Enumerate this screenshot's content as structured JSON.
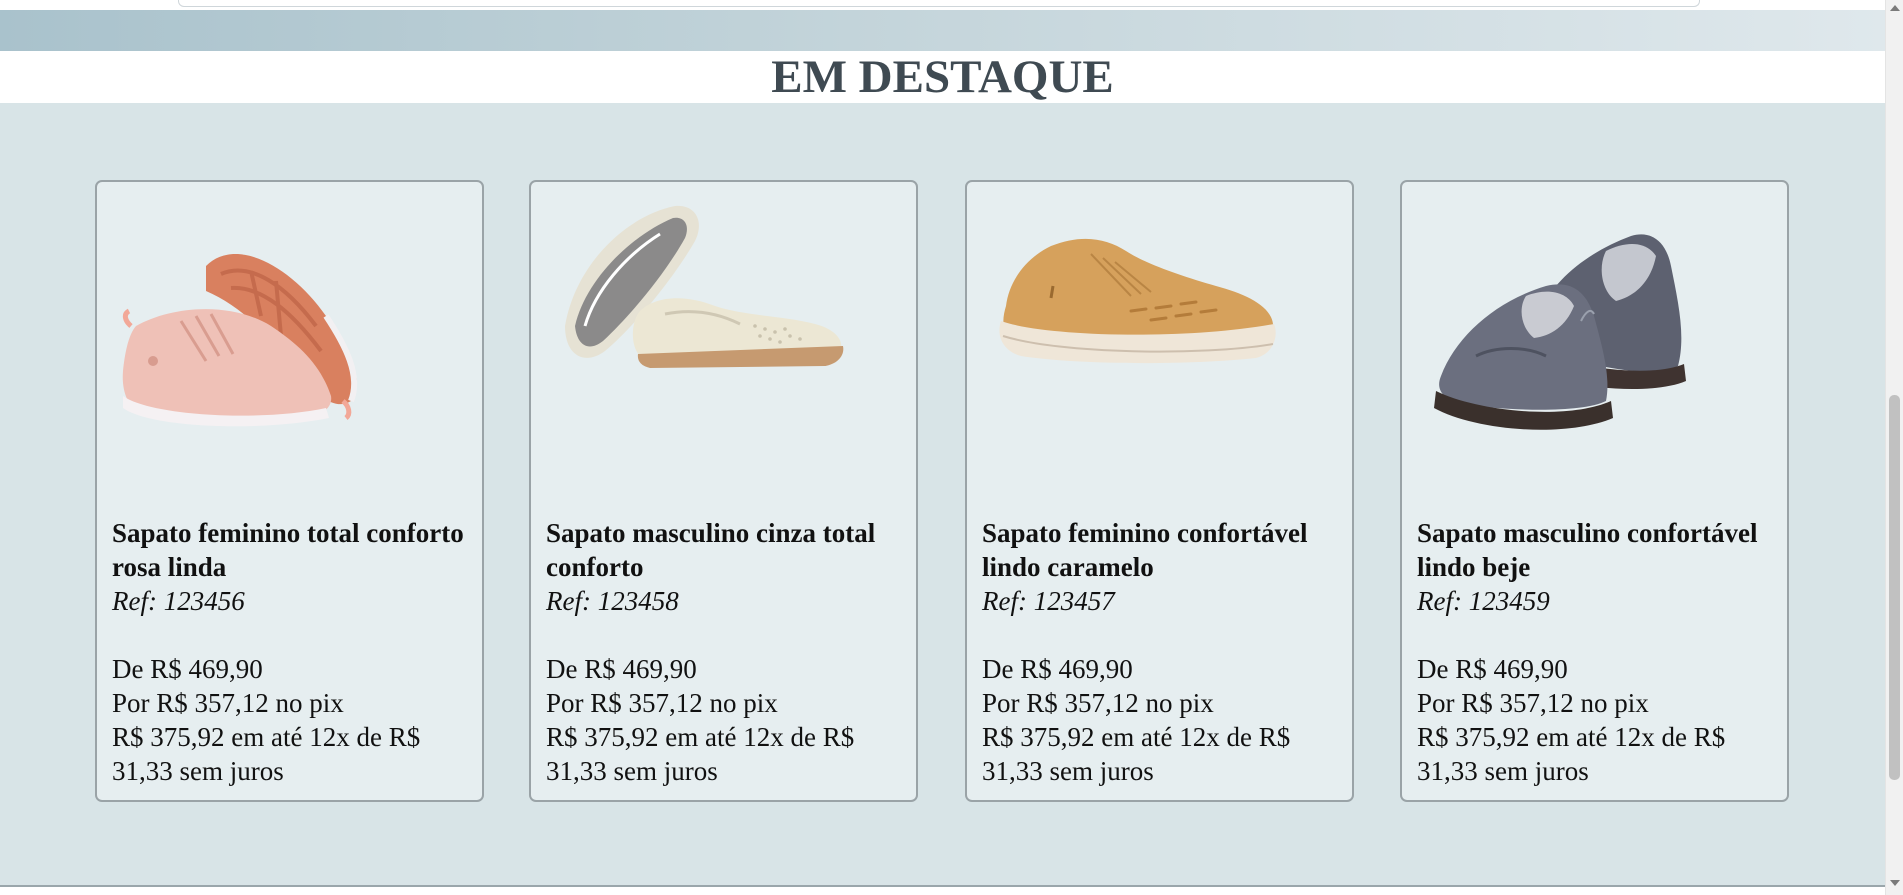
{
  "section": {
    "title": "EM DESTAQUE"
  },
  "products": [
    {
      "name": "Sapato feminino total conforto rosa linda",
      "ref": "Ref: 123456",
      "price_from": "De R$ 469,90",
      "price_pix": "Por R$ 357,12 no pix",
      "installments": "R$ 375,92 em até 12x de R$ 31,33 sem juros",
      "image_icon": "pink-sneaker-image"
    },
    {
      "name": "Sapato masculino cinza total conforto",
      "ref": "Ref: 123458",
      "price_from": "De R$ 469,90",
      "price_pix": "Por R$ 357,12 no pix",
      "installments": "R$ 375,92 em até 12x de R$ 31,33 sem juros",
      "image_icon": "beige-slip-on-image"
    },
    {
      "name": "Sapato feminino confortável lindo caramelo",
      "ref": "Ref: 123457",
      "price_from": "De R$ 469,90",
      "price_pix": "Por R$ 357,12 no pix",
      "installments": "R$ 375,92 em até 12x de R$ 31,33 sem juros",
      "image_icon": "caramel-sneaker-image"
    },
    {
      "name": "Sapato masculino confortável lindo beje",
      "ref": "Ref: 123459",
      "price_from": "De R$ 469,90",
      "price_pix": "Por R$ 357,12 no pix",
      "installments": "R$ 375,92 em até 12x de R$ 31,33 sem juros",
      "image_icon": "grey-loafer-image"
    }
  ],
  "colors": {
    "section_background": "#d8e4e7",
    "card_background": "#e6eef0",
    "card_border": "#9aa3a7",
    "title_color": "#3f4a52"
  }
}
